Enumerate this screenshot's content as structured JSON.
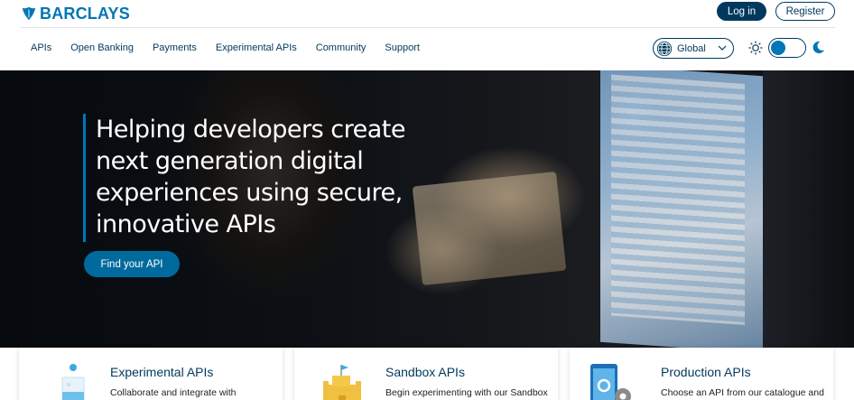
{
  "brand": {
    "name": "BARCLAYS",
    "color": "#0076b6"
  },
  "auth": {
    "login_label": "Log in",
    "register_label": "Register"
  },
  "nav": {
    "items": [
      {
        "label": "APIs"
      },
      {
        "label": "Open Banking"
      },
      {
        "label": "Payments"
      },
      {
        "label": "Experimental APIs"
      },
      {
        "label": "Community"
      },
      {
        "label": "Support"
      }
    ]
  },
  "region_select": {
    "selected": "Global",
    "icon": "globe-icon"
  },
  "theme_toggle": {
    "light_icon": "sun-icon",
    "dark_icon": "moon-icon",
    "mode": "light"
  },
  "hero": {
    "title": "Helping developers create next generation digital experiences using secure, innovative APIs",
    "cta_label": "Find your API"
  },
  "cards": [
    {
      "title": "Experimental APIs",
      "description": "Collaborate and integrate with",
      "icon": "lab-flask-icon"
    },
    {
      "title": "Sandbox APIs",
      "description": "Begin experimenting with our Sandbox",
      "icon": "sandcastle-icon"
    },
    {
      "title": "Production APIs",
      "description": "Choose an API from our catalogue and",
      "icon": "phone-gear-icon"
    }
  ],
  "colors": {
    "primary_dark": "#00395d",
    "accent": "#0076b6",
    "cta": "#006a9e"
  }
}
